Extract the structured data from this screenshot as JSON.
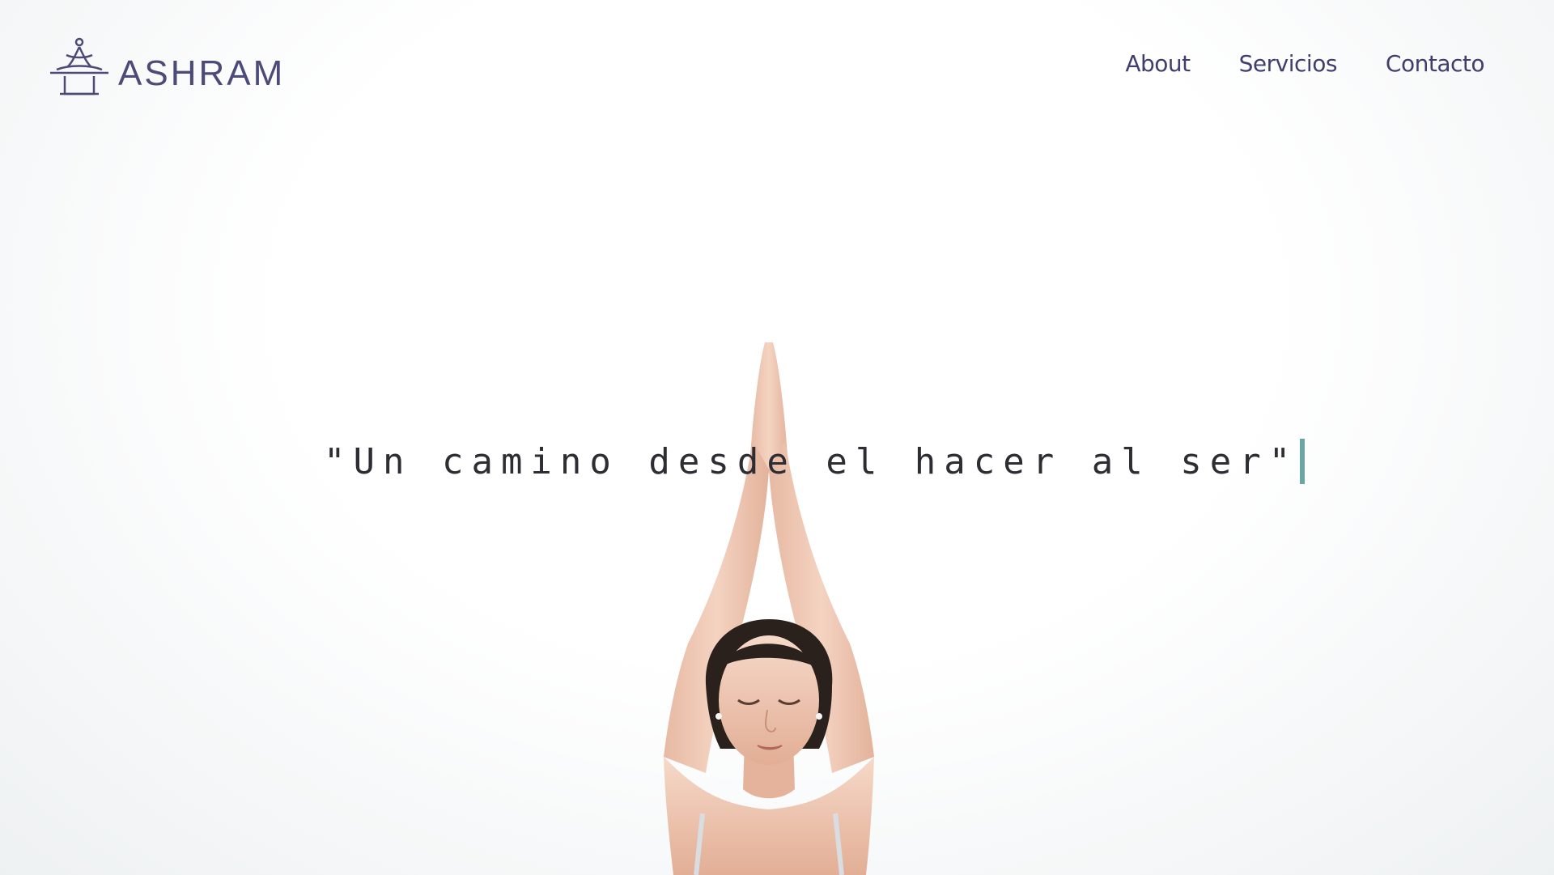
{
  "header": {
    "logo_text": "ASHRAM",
    "logo_icon": "meditating-figure-icon",
    "nav": [
      {
        "label": "About"
      },
      {
        "label": "Servicios"
      },
      {
        "label": "Contacto"
      }
    ]
  },
  "hero": {
    "quote": "\"Un camino desde el hacer al ser\"",
    "cursor_color": "#6aa7a4",
    "image": "woman-meditating-arms-raised"
  },
  "colors": {
    "brand": "#4b4a79",
    "text": "#2d2d33",
    "accent": "#6aa7a4"
  }
}
